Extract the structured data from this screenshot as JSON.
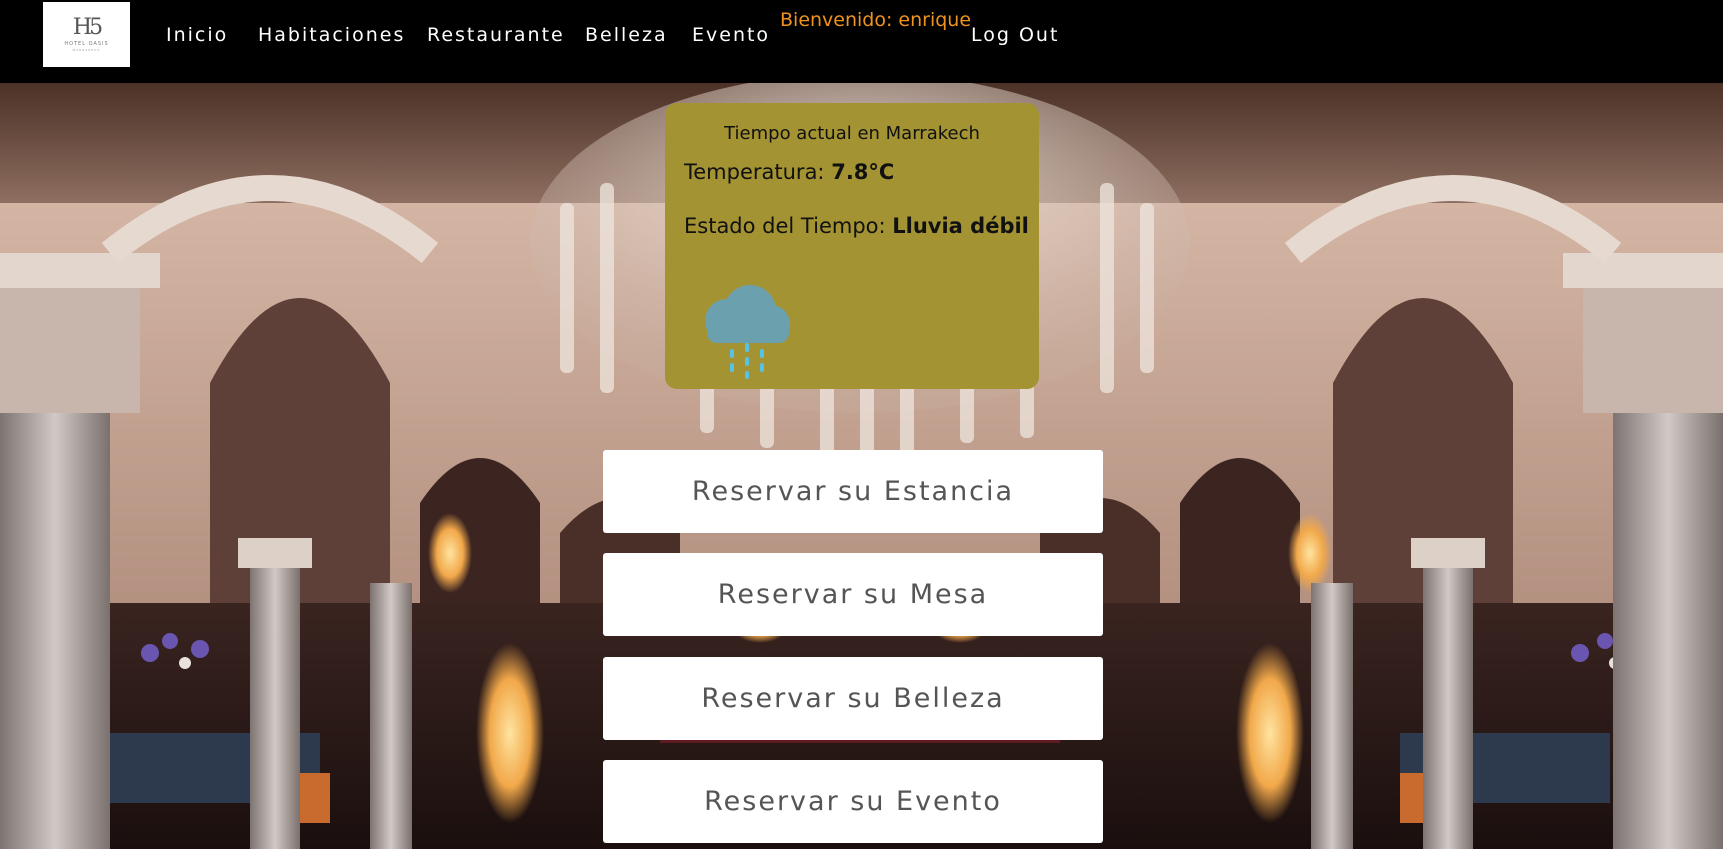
{
  "brand": {
    "logo_mark": "H5",
    "logo_text": "HOTEL OASIS",
    "logo_subtext": "MARRAKECH"
  },
  "nav": {
    "items": [
      {
        "label": "Inicio"
      },
      {
        "label": "Habitaciones"
      },
      {
        "label": "Restaurante"
      },
      {
        "label": "Belleza"
      },
      {
        "label": "Evento"
      }
    ],
    "welcome": "Bienvenido: enrique",
    "logout": "Log Out"
  },
  "weather": {
    "title": "Tiempo actual en Marrakech",
    "temp_label": "Temperatura:",
    "temp_value": "7.8°C",
    "state_label": "Estado del Tiempo:",
    "state_value": "Lluvia débil",
    "icon": "light-rain-icon",
    "card_color": "#a39332"
  },
  "actions": {
    "stay": "Reservar su Estancia",
    "table": "Reservar su Mesa",
    "beauty": "Reservar su Belleza",
    "event": "Reservar su Evento"
  },
  "colors": {
    "nav_bg": "#000000",
    "welcome": "#f0931e",
    "button_bg": "#ffffff",
    "button_text": "#555555"
  }
}
